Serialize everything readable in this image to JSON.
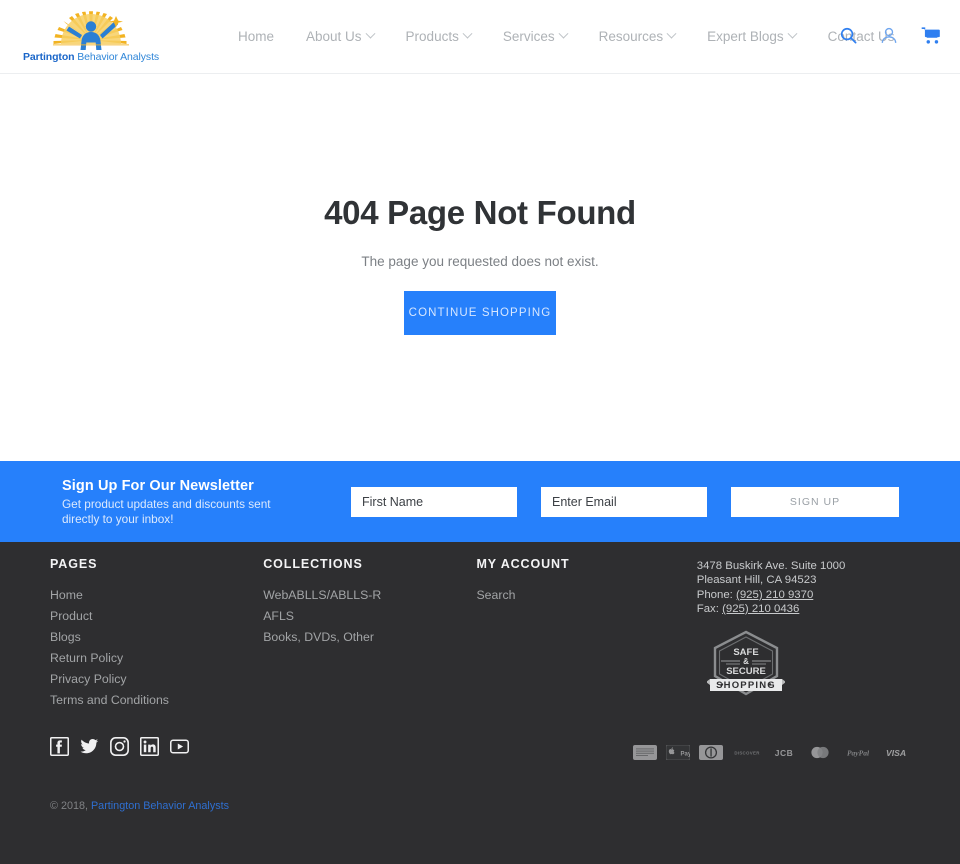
{
  "brand": {
    "name_bold": "Partington",
    "name_rest": " Behavior Analysts",
    "logo_icon": "sunburst-person-logo"
  },
  "header": {
    "nav": [
      {
        "label": "Home",
        "has_caret": false
      },
      {
        "label": "About Us",
        "has_caret": true
      },
      {
        "label": "Products",
        "has_caret": true
      },
      {
        "label": "Services",
        "has_caret": true
      },
      {
        "label": "Resources",
        "has_caret": true
      },
      {
        "label": "Expert Blogs",
        "has_caret": true
      },
      {
        "label": "Contact Us",
        "has_caret": false
      }
    ],
    "icons": [
      {
        "name": "search-icon"
      },
      {
        "name": "account-icon"
      },
      {
        "name": "cart-icon"
      }
    ],
    "icon_color": "#2f7ff0"
  },
  "main": {
    "heading": "404 Page Not Found",
    "subtext": "The page you requested does not exist.",
    "button_label": "CONTINUE SHOPPING",
    "button_color": "#2680fb"
  },
  "newsletter": {
    "title": "Sign Up For Our Newsletter",
    "subtitle_line1": "Get product updates and discounts sent",
    "subtitle_line2": "directly to your inbox!",
    "first_name_placeholder": "First Name",
    "email_placeholder": "Enter Email",
    "submit_label": "SIGN UP",
    "background": "#2680fb"
  },
  "footer": {
    "background": "#2e2e30",
    "pages": {
      "heading": "PAGES",
      "links": [
        "Home",
        "Product",
        "Blogs",
        "Return Policy",
        "Privacy Policy",
        "Terms and Conditions"
      ]
    },
    "collections": {
      "heading": "COLLECTIONS",
      "links": [
        "WebABLLS/ABLLS-R",
        "AFLS",
        "Books, DVDs, Other"
      ]
    },
    "account": {
      "heading": "MY ACCOUNT",
      "links": [
        "Search"
      ]
    },
    "contact": {
      "address_line1": "3478 Buskirk Ave. Suite 1000",
      "address_line2": "Pleasant Hill, CA 94523",
      "phone_label": "Phone: ",
      "phone": "(925) 210 9370",
      "fax_label": "Fax: ",
      "fax": "(925) 210 0436",
      "badge": {
        "name": "safe-secure-shopping-badge",
        "line1": "SAFE",
        "amp": "&",
        "line2": "SECURE",
        "ribbon": "SHOPPING"
      }
    },
    "socials": [
      {
        "name": "facebook-icon"
      },
      {
        "name": "twitter-icon"
      },
      {
        "name": "instagram-icon"
      },
      {
        "name": "linkedin-icon"
      },
      {
        "name": "youtube-icon"
      }
    ],
    "payments": [
      {
        "name": "american-express-icon",
        "label": ""
      },
      {
        "name": "apple-pay-icon",
        "label": "Pay"
      },
      {
        "name": "diners-club-icon",
        "label": ""
      },
      {
        "name": "discover-icon",
        "label": "DISCOVER"
      },
      {
        "name": "jcb-icon",
        "label": "JCB"
      },
      {
        "name": "mastercard-icon",
        "label": ""
      },
      {
        "name": "paypal-icon",
        "label": "PayPal"
      },
      {
        "name": "visa-icon",
        "label": "VISA"
      }
    ],
    "copyright_prefix": "© 2018, ",
    "copyright_link": "Partington Behavior Analysts"
  }
}
